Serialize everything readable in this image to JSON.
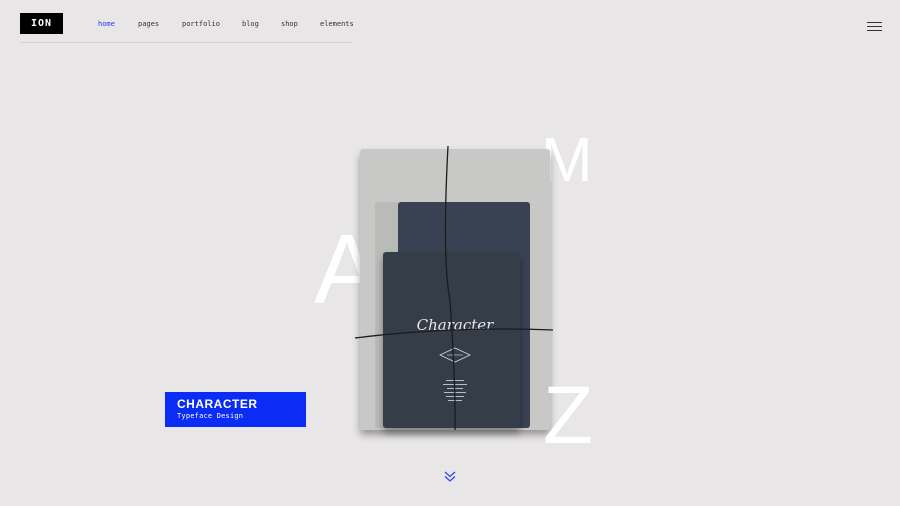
{
  "header": {
    "logo": "ION",
    "nav": [
      {
        "label": "home",
        "active": true
      },
      {
        "label": "pages",
        "active": false
      },
      {
        "label": "portfolio",
        "active": false
      },
      {
        "label": "blog",
        "active": false
      },
      {
        "label": "shop",
        "active": false
      },
      {
        "label": "elements",
        "active": false
      }
    ],
    "menu_icon": "hamburger-icon"
  },
  "hero": {
    "letters": [
      "A",
      "M",
      "Z"
    ],
    "notebook_title": "Character",
    "badge": {
      "title": "CHARACTER",
      "subtitle": "Typeface Design"
    },
    "scroll_icon": "double-chevron-down-icon"
  },
  "colors": {
    "background": "#e8e6e7",
    "accent": "#1e3df2",
    "badge": "#0a2cf5",
    "notebook": "#343c4a"
  }
}
